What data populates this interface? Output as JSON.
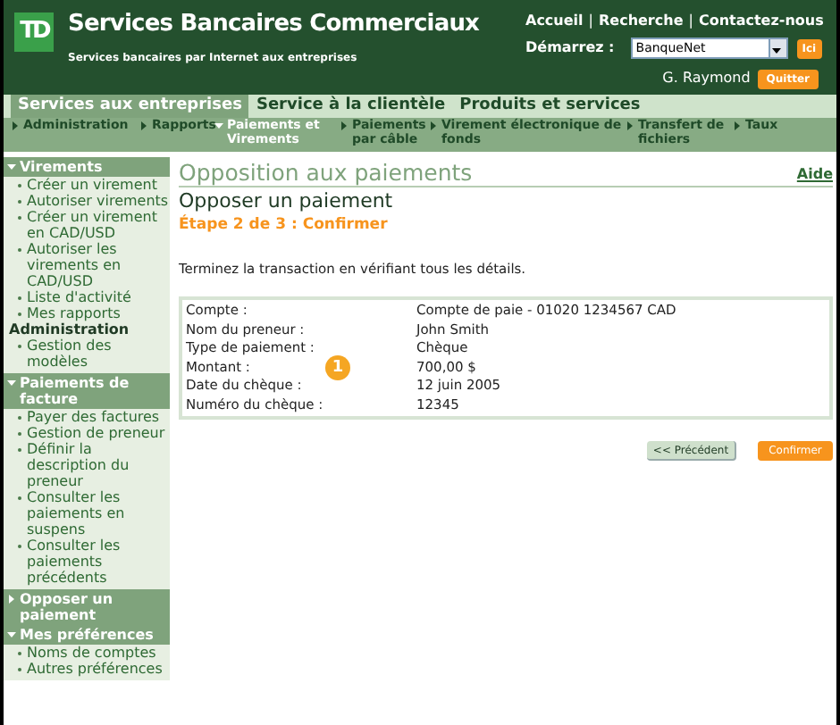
{
  "header": {
    "logo": "TD",
    "title": "Services Bancaires Commerciaux",
    "subtitle": "Services bancaires par Internet aux entreprises",
    "links": [
      "Accueil",
      "|",
      "Recherche",
      "|",
      "Contactez-nous"
    ],
    "start_label": "Démarrez :",
    "start_select": "BanqueNet",
    "go_button": "Ici",
    "user": "G. Raymond",
    "logout_button": "Quitter"
  },
  "tabs": [
    {
      "label": "Services aux entreprises",
      "selected": true
    },
    {
      "label": "Service à la clientèle",
      "selected": false
    },
    {
      "label": "Produits et services",
      "selected": false
    }
  ],
  "subnav": [
    {
      "label": "Administration",
      "selected": false
    },
    {
      "label": "Rapports",
      "selected": false
    },
    {
      "label": "Paiements et Virements",
      "selected": true
    },
    {
      "label": "Paiements par câble",
      "selected": false
    },
    {
      "label": "Virement électronique de fonds",
      "selected": false
    },
    {
      "label": "Transfert de fichiers",
      "selected": false
    },
    {
      "label": "Taux",
      "selected": false
    }
  ],
  "sidebar": [
    {
      "label": "Virements",
      "expanded": true,
      "items": [
        {
          "kind": "link",
          "label": "Créer un virement"
        },
        {
          "kind": "link",
          "label": "Autoriser virements"
        },
        {
          "kind": "link",
          "label": "Créer un virement en CAD/USD"
        },
        {
          "kind": "link",
          "label": "Autoriser les virements en CAD/USD"
        },
        {
          "kind": "link",
          "label": "Liste d'activité"
        },
        {
          "kind": "link",
          "label": "Mes rapports"
        },
        {
          "kind": "heading",
          "label": "Administration"
        },
        {
          "kind": "link",
          "label": "Gestion des modèles"
        }
      ]
    },
    {
      "label": "Paiements de facture",
      "expanded": true,
      "items": [
        {
          "kind": "link",
          "label": "Payer des factures"
        },
        {
          "kind": "link",
          "label": "Gestion de preneur"
        },
        {
          "kind": "link",
          "label": "Définir la description du preneur"
        },
        {
          "kind": "link",
          "label": "Consulter les paiements en suspens"
        },
        {
          "kind": "link",
          "label": "Consulter les paiements précédents"
        }
      ]
    },
    {
      "label": "Opposer un paiement",
      "expanded": false
    },
    {
      "label": "Mes préférences",
      "expanded": true,
      "items": [
        {
          "kind": "link",
          "label": "Noms de comptes"
        },
        {
          "kind": "link",
          "label": "Autres préférences"
        }
      ]
    }
  ],
  "content": {
    "section_title": "Opposition aux paiements",
    "help_link": "Aide",
    "title": "Opposer un paiement",
    "step": "Étape 2 de 3 : Confirmer",
    "instructions": "Terminez la transaction en vérifiant tous les détails.",
    "details": [
      {
        "label": "Compte :",
        "value": "Compte de paie - 01020 1234567 CAD"
      },
      {
        "label": "Nom du preneur :",
        "value": "John Smith"
      },
      {
        "label": "Type de paiement :",
        "value": "Chèque"
      },
      {
        "label": "Montant :",
        "value": "700,00 $"
      },
      {
        "label": "Date du chèque :",
        "value": "12 juin 2005"
      },
      {
        "label": "Numéro du chèque :",
        "value": "12345"
      }
    ],
    "callout": "1",
    "buttons": [
      {
        "kind": "secondary",
        "label": "<< Précédent"
      },
      {
        "kind": "primary",
        "label": "Confirmer"
      }
    ]
  }
}
